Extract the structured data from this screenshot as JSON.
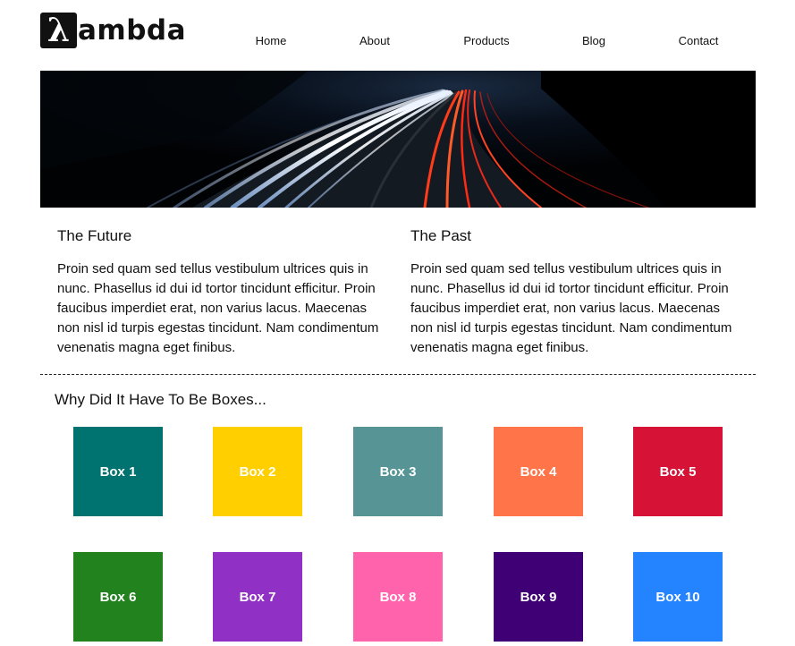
{
  "logo": {
    "mark": "λ",
    "text": "ambda"
  },
  "nav": [
    {
      "label": "Home"
    },
    {
      "label": "About"
    },
    {
      "label": "Products"
    },
    {
      "label": "Blog"
    },
    {
      "label": "Contact"
    }
  ],
  "hero": {
    "image": "night-highway-light-trails"
  },
  "columns": [
    {
      "heading": "The Future",
      "body": "Proin sed quam sed tellus vestibulum ultrices quis in nunc. Phasellus id dui id tortor tincidunt efficitur. Proin faucibus imperdiet erat, non varius lacus. Maecenas non nisl id turpis egestas tincidunt. Nam condimentum venenatis magna eget finibus."
    },
    {
      "heading": "The Past",
      "body": "Proin sed quam sed tellus vestibulum ultrices quis in nunc. Phasellus id dui id tortor tincidunt efficitur. Proin faucibus imperdiet erat, non varius lacus. Maecenas non nisl id turpis egestas tincidunt. Nam condimentum venenatis magna eget finibus."
    }
  ],
  "boxes_section": {
    "title": "Why Did It Have To Be Boxes...",
    "boxes": [
      {
        "label": "Box 1",
        "color": "#007370"
      },
      {
        "label": "Box 2",
        "color": "#FFCF00"
      },
      {
        "label": "Box 3",
        "color": "#569495"
      },
      {
        "label": "Box 4",
        "color": "#FF7448"
      },
      {
        "label": "Box 5",
        "color": "#D61236"
      },
      {
        "label": "Box 6",
        "color": "#21821E"
      },
      {
        "label": "Box 7",
        "color": "#9030C4"
      },
      {
        "label": "Box 8",
        "color": "#FF63AC"
      },
      {
        "label": "Box 9",
        "color": "#3F0075"
      },
      {
        "label": "Box 10",
        "color": "#2484FF"
      }
    ]
  }
}
